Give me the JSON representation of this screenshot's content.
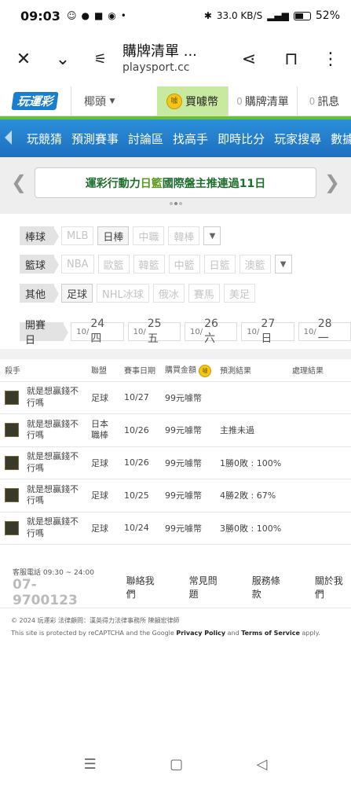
{
  "status": {
    "time": "09:03",
    "network": "33.0 KB/S",
    "battery": "52%"
  },
  "browser": {
    "title": "購牌清單 ...",
    "url": "playsport.cc"
  },
  "site": {
    "logo": "玩運彩",
    "team_select": "椰頭",
    "buy_label": "買噱幣",
    "coin_text": "噱",
    "cart_count": "0",
    "cart_label": "購牌清單",
    "msg_count": "0",
    "msg_label": "訊息"
  },
  "nav": [
    "玩競猜",
    "預測賽事",
    "討論區",
    "找高手",
    "即時比分",
    "玩家搜尋",
    "數據"
  ],
  "banner": {
    "text_a": "運彩行動力 ",
    "text_hl": "日籃",
    "text_b": " 國際盤主推連過11日"
  },
  "filters": {
    "baseball": {
      "label": "棒球",
      "items": [
        "MLB",
        "日棒",
        "中職",
        "韓棒"
      ]
    },
    "basketball": {
      "label": "籃球",
      "items": [
        "NBA",
        "歐籃",
        "韓籃",
        "中籃",
        "日籃",
        "澳籃"
      ]
    },
    "other": {
      "label": "其他",
      "items": [
        "足球",
        "NHL冰球",
        "俄冰",
        "賽馬",
        "美足"
      ]
    },
    "dates": {
      "label": "開賽日",
      "items": [
        {
          "m": "10/",
          "d": "24 四"
        },
        {
          "m": "10/",
          "d": "25 五"
        },
        {
          "m": "10/",
          "d": "26 六"
        },
        {
          "m": "10/",
          "d": "27 日"
        },
        {
          "m": "10/",
          "d": "28 一"
        }
      ]
    }
  },
  "table": {
    "headers": [
      "殺手",
      "聯盟",
      "賽事日期",
      "購買金額",
      "預測結果",
      "處理結果"
    ],
    "coin_text": "噱",
    "rows": [
      {
        "player": "就是想贏錢不行嗎",
        "league": "足球",
        "date": "10/27",
        "amount": "99元噱幣",
        "result": "",
        "process": ""
      },
      {
        "player": "就是想贏錢不行嗎",
        "league": "日本職棒",
        "date": "10/26",
        "amount": "99元噱幣",
        "result": "主推未過",
        "process": ""
      },
      {
        "player": "就是想贏錢不行嗎",
        "league": "足球",
        "date": "10/26",
        "amount": "99元噱幣",
        "result": "1勝0敗 : 100%",
        "process": ""
      },
      {
        "player": "就是想贏錢不行嗎",
        "league": "足球",
        "date": "10/25",
        "amount": "99元噱幣",
        "result": "4勝2敗 : 67%",
        "process": ""
      },
      {
        "player": "就是想贏錢不行嗎",
        "league": "足球",
        "date": "10/24",
        "amount": "99元噱幣",
        "result": "3勝0敗 : 100%",
        "process": ""
      }
    ]
  },
  "footer": {
    "cs_label": "客服電話 09:30 ~ 24:00",
    "phone": "07-9700123",
    "links": [
      "聯絡我們",
      "常見問題",
      "服務條款",
      "關於我們"
    ],
    "copyright": "© 2024 玩運彩 法律顧問：漢英得力法律事務所 陳韻宏律師",
    "recaptcha_a": "This site is protected by reCAPTCHA and the Google ",
    "privacy": "Privacy Policy",
    "and": " and ",
    "terms": "Terms of Service",
    "apply": " apply."
  }
}
